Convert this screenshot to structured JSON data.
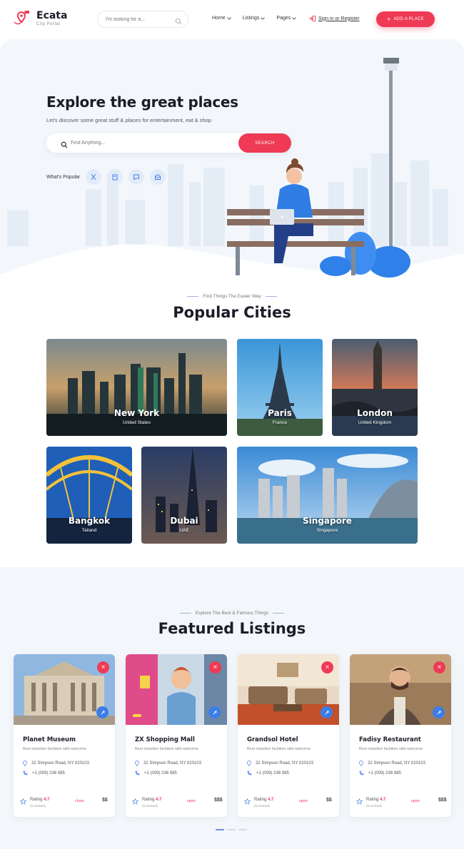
{
  "brand": {
    "name": "Ecata",
    "tagline": "City Portal",
    "accent": "#ef3a55",
    "blue": "#3c7de8"
  },
  "header": {
    "search_placeholder": "I'm looking for a...",
    "nav": [
      {
        "label": "Home"
      },
      {
        "label": "Listings"
      },
      {
        "label": "Pages"
      }
    ],
    "signin": "Sign in or Register",
    "add_place": "ADD A PLACE"
  },
  "hero": {
    "title": "Explore the great places",
    "subtitle": "Let's discover some great stuff & places for entertainment, eat & shop",
    "search_placeholder": "Find Anything...",
    "search_button": "SEARCH",
    "popular_label": "What's Popular",
    "popular_icons": [
      "restaurant-icon",
      "shopping-icon",
      "chat-icon",
      "mail-icon"
    ]
  },
  "cities_section": {
    "tag": "Find Things The Easier Way",
    "title": "Popular Cities",
    "cities": [
      {
        "name": "New York",
        "country": "United States"
      },
      {
        "name": "Paris",
        "country": "France"
      },
      {
        "name": "London",
        "country": "United Kingdom"
      },
      {
        "name": "Bangkok",
        "country": "Tailand"
      },
      {
        "name": "Dubai",
        "country": "UAE"
      },
      {
        "name": "Singapore",
        "country": "Singapore"
      }
    ]
  },
  "featured_section": {
    "tag": "Explore The Best & Famous Things",
    "title": "Featured Listings",
    "listings": [
      {
        "title": "Planet Museum",
        "desc": "Best relaxtion facilities with welcome",
        "address": "32 Simpson Road, NY 020103",
        "phone": "+1 (009) 236 985",
        "rating_label": "Rating",
        "rating": "4.7",
        "reviews": "(5 reviews)",
        "status": "close",
        "price": "$$"
      },
      {
        "title": "ZX Shopping Mall",
        "desc": "Best relaxtion facilities with welcome",
        "address": "32 Simpson Road, NY 020103",
        "phone": "+1 (009) 236 985",
        "rating_label": "Rating",
        "rating": "4.7",
        "reviews": "(5 reviews)",
        "status": "open",
        "price": "$$$"
      },
      {
        "title": "Grandsol Hotel",
        "desc": "Best relaxtion facilities with welcome",
        "address": "32 Simpson Road, NY 020103",
        "phone": "+1 (009) 236 985",
        "rating_label": "Rating",
        "rating": "4.7",
        "reviews": "(5 reviews)",
        "status": "open",
        "price": "$$"
      },
      {
        "title": "Fadisy Restaurant",
        "desc": "Best relaxtion facilities with welcome",
        "address": "32 Simpson Road, NY 020103",
        "phone": "+1 (009) 236 985",
        "rating_label": "Rating",
        "rating": "4.7",
        "reviews": "(5 reviews)",
        "status": "open",
        "price": "$$$"
      }
    ]
  }
}
